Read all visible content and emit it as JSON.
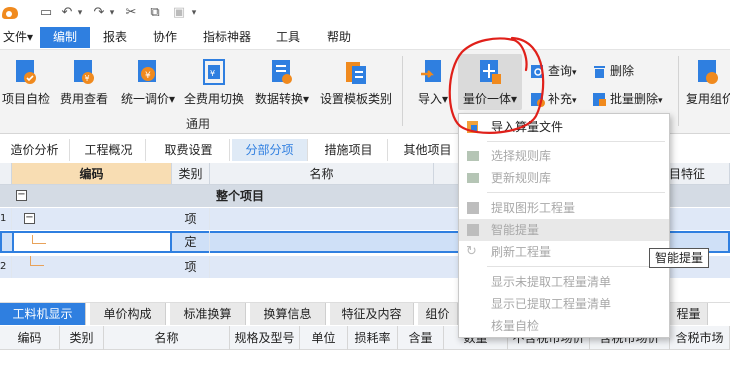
{
  "quick_access": {
    "save_icon": "save-icon",
    "undo_icon": "undo-icon",
    "redo_icon": "redo-icon"
  },
  "menu": {
    "file": "文件",
    "items": [
      "编制",
      "报表",
      "协作",
      "指标神器",
      "工具",
      "帮助"
    ],
    "active": "编制"
  },
  "ribbon": {
    "buttons": [
      "项目自检",
      "费用查看",
      "统一调价",
      "全费用切换",
      "数据转换",
      "设置模板类别"
    ],
    "group_label": "通用",
    "import_label": "导入",
    "qty_price_label": "量价一体",
    "query_label": "查询",
    "add_label": "补充",
    "delete_label": "删除",
    "batch_delete_label": "批量删除",
    "reuse_label": "复用组价"
  },
  "view_tabs": [
    "造价分析",
    "工程概况",
    "取费设置",
    "分部分项",
    "措施项目",
    "其他项目"
  ],
  "view_tabs_active": "分部分项",
  "grid": {
    "headers": {
      "code": "编码",
      "type": "类别",
      "name": "名称",
      "feature": "目特征"
    },
    "rows": [
      {
        "num": "",
        "type": "",
        "name": "整个项目"
      },
      {
        "num": "1",
        "type": "项",
        "name": ""
      },
      {
        "num": "",
        "type": "定",
        "name": ""
      },
      {
        "num": "2",
        "type": "项",
        "name": ""
      }
    ]
  },
  "dropdown": {
    "items": [
      {
        "label": "导入算量文件",
        "enabled": true
      },
      {
        "label": "选择规则库",
        "enabled": false
      },
      {
        "label": "更新规则库",
        "enabled": false
      },
      {
        "label": "提取图形工程量",
        "enabled": false
      },
      {
        "label": "智能提量",
        "enabled": false
      },
      {
        "label": "刷新工程量",
        "enabled": false
      },
      {
        "label": "显示未提取工程量清单",
        "enabled": false
      },
      {
        "label": "显示已提取工程量清单",
        "enabled": false
      },
      {
        "label": "核量自检",
        "enabled": false
      }
    ]
  },
  "tooltip": "智能提量",
  "bottom_tabs": [
    "工料机显示",
    "单价构成",
    "标准换算",
    "换算信息",
    "特征及内容",
    "组价",
    "程量"
  ],
  "bottom_tabs_active": "工料机显示",
  "bottom_grid": {
    "headers": [
      "编码",
      "类别",
      "名称",
      "规格及型号",
      "单位",
      "损耗率",
      "含量",
      "数量",
      "不含税市场价",
      "含税市场价",
      "含税市场"
    ]
  },
  "colors": {
    "accent": "#2f7fe0",
    "annotation": "#e0201a",
    "column_highlight": "#f8ddb3"
  }
}
